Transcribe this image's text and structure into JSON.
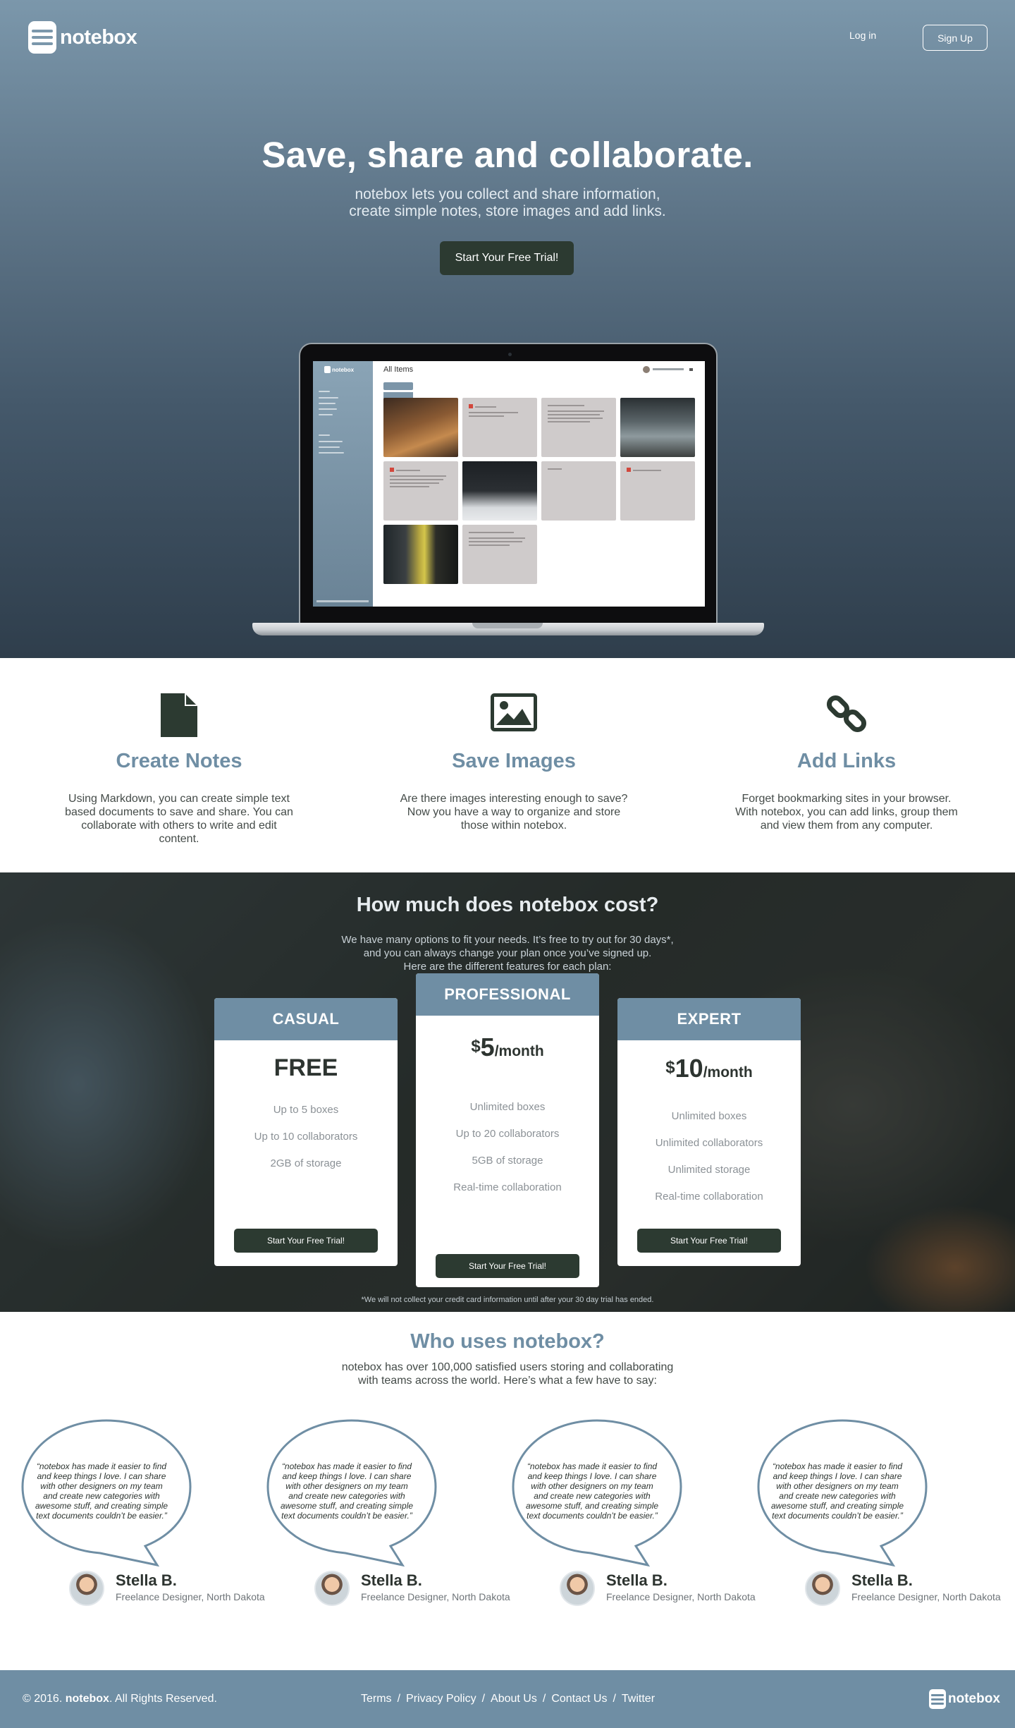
{
  "brand": {
    "name": "notebox",
    "accent": "#6f8ea4",
    "dark": "#2c3a31"
  },
  "nav": {
    "login": "Log in",
    "signup": "Sign Up"
  },
  "hero": {
    "title": "Save, share and collaborate.",
    "subtitle_line1": "notebox lets you collect and share information,",
    "subtitle_line2": "create simple notes, store images and add links.",
    "cta": "Start Your Free Trial!"
  },
  "app_preview": {
    "brand": "notebox",
    "heading": "All Items"
  },
  "features": [
    {
      "icon": "document-icon",
      "title": "Create Notes",
      "desc": "Using Markdown, you can create simple text based documents to save and share. You can collaborate with others to write and edit content."
    },
    {
      "icon": "image-icon",
      "title": "Save Images",
      "desc": "Are there images interesting enough to save? Now you have a way to organize and store those within notebox."
    },
    {
      "icon": "link-icon",
      "title": "Add Links",
      "desc": "Forget bookmarking sites in your browser. With notebox, you can add links, group them and view them from any computer."
    }
  ],
  "pricing": {
    "title": "How much does notebox cost?",
    "subtitle_line1": "We have many options to fit your needs. It’s free to try out for 30 days*,",
    "subtitle_line2": "and you can always change your plan once you’ve signed up.",
    "subtitle_line3": "Here are the different features for each plan:",
    "plans": [
      {
        "name": "CASUAL",
        "price": "FREE",
        "features": [
          "Up to 5 boxes",
          "Up to 10 collaborators",
          "2GB of storage"
        ],
        "cta": "Start Your Free Trial!"
      },
      {
        "name": "PROFESSIONAL",
        "currency": "$",
        "amount": "5",
        "period": "/month",
        "features": [
          "Unlimited boxes",
          "Up to 20 collaborators",
          "5GB of storage",
          "Real-time collaboration"
        ],
        "cta": "Start Your Free Trial!"
      },
      {
        "name": "EXPERT",
        "currency": "$",
        "amount": "10",
        "period": "/month",
        "features": [
          "Unlimited boxes",
          "Unlimited collaborators",
          "Unlimited storage",
          "Real-time collaboration"
        ],
        "cta": "Start Your Free Trial!"
      }
    ],
    "note": "*We will not collect your credit card information until after your 30 day trial has ended."
  },
  "testimonials": {
    "title": "Who uses notebox?",
    "subtitle_line1": "notebox has over 100,000 satisfied users storing and collaborating",
    "subtitle_line2": "with teams across the world. Here’s what a few have to say:",
    "items": [
      {
        "quote": "“notebox has made it easier to find and keep things I love. I can share with other designers on my team and create new categories with awesome stuff, and creating simple text documents couldn’t be easier.”",
        "name": "Stella B.",
        "role": "Freelance Designer, North Dakota"
      },
      {
        "quote": "“notebox has made it easier to find and keep things I love. I can share with other designers on my team and create new categories with awesome stuff, and creating simple text documents couldn’t be easier.”",
        "name": "Stella B.",
        "role": "Freelance Designer, North Dakota"
      },
      {
        "quote": "“notebox has made it easier to find and keep things I love. I can share with other designers on my team and create new categories with awesome stuff, and creating simple text documents couldn’t be easier.”",
        "name": "Stella B.",
        "role": "Freelance Designer, North Dakota"
      },
      {
        "quote": "“notebox has made it easier to find and keep things I love. I can share with other designers on my team and create new categories with awesome stuff, and creating simple text documents couldn’t be easier.”",
        "name": "Stella B.",
        "role": "Freelance Designer, North Dakota"
      }
    ]
  },
  "footer": {
    "copyright_prefix": "© 2016.",
    "copyright_brand": "notebox",
    "copyright_suffix": ". All Rights Reserved.",
    "links": [
      "Terms",
      "Privacy Policy",
      "About Us",
      "Contact Us",
      "Twitter"
    ],
    "separator": "/",
    "logo": "notebox"
  }
}
